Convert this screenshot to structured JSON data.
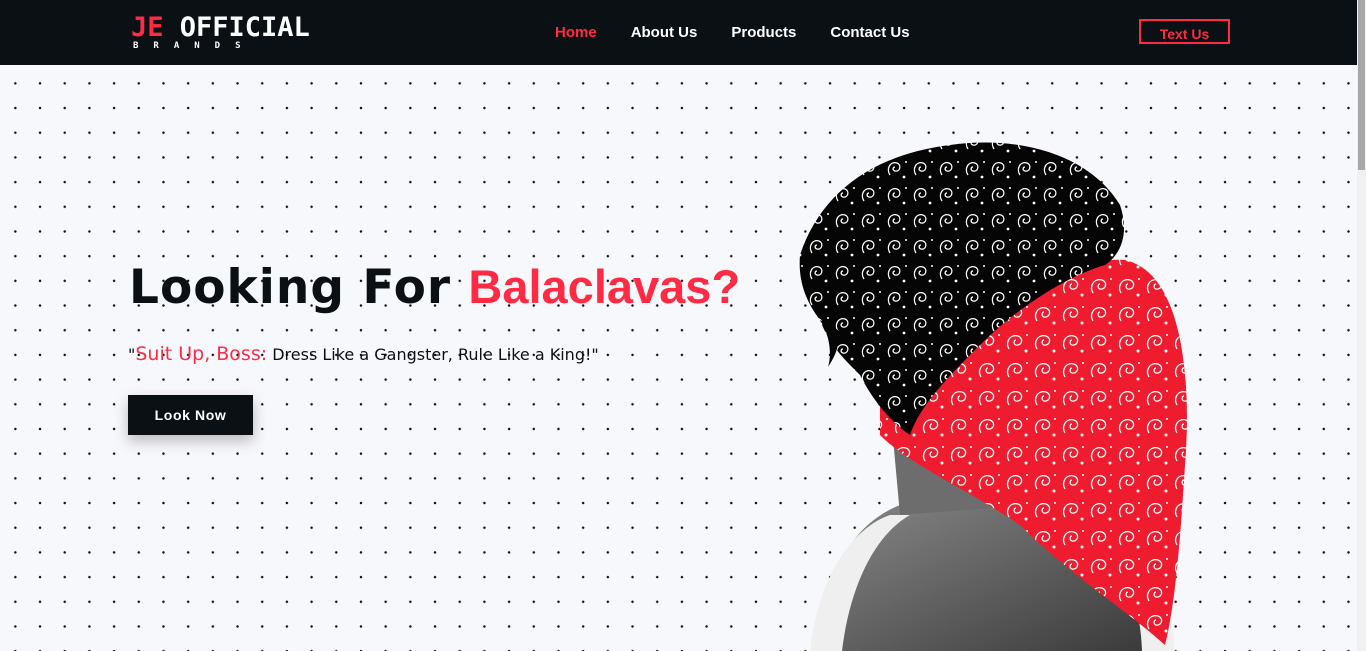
{
  "brand": {
    "logo_prefix": "JE",
    "logo_main": " OFFICIAL",
    "logo_sub": "BRANDS"
  },
  "nav": {
    "items": [
      {
        "label": "Home",
        "active": true
      },
      {
        "label": "About Us",
        "active": false
      },
      {
        "label": "Products",
        "active": false
      },
      {
        "label": "Contact Us",
        "active": false
      }
    ],
    "cta_label": "Text Us"
  },
  "hero": {
    "title_part1": "Looking For ",
    "title_accent": "Balaclavas?",
    "tagline_quote_open": "\"",
    "tagline_accent": "Suit Up, Boss:",
    "tagline_rest": " Dress Like a Gangster, Rule Like a King!\"",
    "button_label": "Look Now",
    "image": "man-with-bandana-icon"
  },
  "colors": {
    "accent": "#ff2b44",
    "dark": "#0b1014",
    "background": "#f7f8fc"
  }
}
